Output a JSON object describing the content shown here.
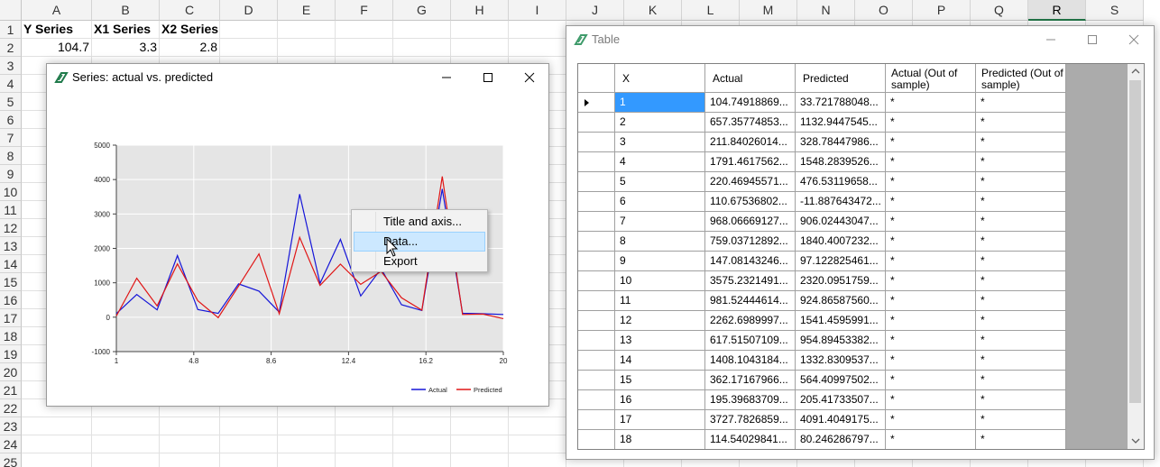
{
  "spreadsheet": {
    "columns": [
      "A",
      "B",
      "C",
      "D",
      "E",
      "F",
      "G",
      "H",
      "I",
      "J",
      "K",
      "L",
      "M",
      "N",
      "O",
      "P",
      "Q",
      "R",
      "S"
    ],
    "selected_column": "R",
    "rows": [
      "1",
      "2",
      "3",
      "4",
      "5",
      "6",
      "7",
      "8",
      "9",
      "10",
      "11",
      "12",
      "13",
      "14",
      "15",
      "16",
      "17",
      "18",
      "19",
      "20",
      "21",
      "22",
      "23",
      "24",
      "25"
    ],
    "headers": {
      "y_series": "Y Series",
      "x1_series": "X1 Series",
      "x2_series": "X2 Series"
    },
    "row2": {
      "y": "104.7",
      "x1": "3.3",
      "x2": "2.8"
    }
  },
  "chart_window": {
    "title": "Series: actual vs. predicted",
    "logo_icon": "green-leaf-icon",
    "controls": [
      "minimize-icon",
      "maximize-icon",
      "close-icon"
    ]
  },
  "context_menu": {
    "items": [
      "Title and axis...",
      "Data...",
      "Export"
    ],
    "hovered_index": 1
  },
  "chart_data": {
    "type": "line",
    "x": [
      1,
      2,
      3,
      4,
      5,
      6,
      7,
      8,
      9,
      10,
      11,
      12,
      13,
      14,
      15,
      16,
      17,
      18,
      19,
      20
    ],
    "x_ticks": [
      "1",
      "4.8",
      "8.6",
      "12.4",
      "16.2",
      "20"
    ],
    "y_ticks": [
      "5000",
      "4000",
      "3000",
      "2000",
      "1000",
      "0",
      "-1000"
    ],
    "xlim": [
      1,
      20
    ],
    "ylim": [
      -1000,
      5000
    ],
    "grid": true,
    "legend_position": "bottom-right",
    "series": [
      {
        "name": "Actual",
        "color": "#1515d8",
        "values": [
          104.7,
          657.4,
          211.8,
          1791.5,
          220.5,
          110.7,
          968.1,
          759.0,
          147.1,
          3575.2,
          981.5,
          2262.7,
          617.5,
          1408.1,
          362.2,
          195.4,
          3727.8,
          114.5,
          100,
          80
        ]
      },
      {
        "name": "Predicted",
        "color": "#e01515",
        "values": [
          33.7,
          1132.9,
          328.8,
          1548.3,
          476.5,
          -11.9,
          906.0,
          1840.0,
          97.1,
          2320.1,
          924.9,
          1541.5,
          954.9,
          1332.8,
          564.4,
          205.4,
          4091.4,
          80.2,
          90,
          -40
        ]
      }
    ]
  },
  "table_window": {
    "title": "Table",
    "logo_icon": "green-leaf-icon",
    "controls": [
      "minimize-icon",
      "maximize-icon",
      "close-icon"
    ],
    "columns": [
      "X",
      "Actual",
      "Predicted",
      "Actual (Out of sample)",
      "Predicted (Out of sample)"
    ],
    "selected_row_index": 0,
    "rows": [
      [
        "1",
        "104.74918869...",
        "33.721788048...",
        "*",
        "*"
      ],
      [
        "2",
        "657.35774853...",
        "1132.9447545...",
        "*",
        "*"
      ],
      [
        "3",
        "211.84026014...",
        "328.78447986...",
        "*",
        "*"
      ],
      [
        "4",
        "1791.4617562...",
        "1548.2839526...",
        "*",
        "*"
      ],
      [
        "5",
        "220.46945571...",
        "476.53119658...",
        "*",
        "*"
      ],
      [
        "6",
        "110.67536802...",
        "-11.887643472...",
        "*",
        "*"
      ],
      [
        "7",
        "968.06669127...",
        "906.02443047...",
        "*",
        "*"
      ],
      [
        "8",
        "759.03712892...",
        "1840.4007232...",
        "*",
        "*"
      ],
      [
        "9",
        "147.08143246...",
        "97.122825461...",
        "*",
        "*"
      ],
      [
        "10",
        "3575.2321491...",
        "2320.0951759...",
        "*",
        "*"
      ],
      [
        "11",
        "981.52444614...",
        "924.86587560...",
        "*",
        "*"
      ],
      [
        "12",
        "2262.6989997...",
        "1541.4595991...",
        "*",
        "*"
      ],
      [
        "13",
        "617.51507109...",
        "954.89453382...",
        "*",
        "*"
      ],
      [
        "14",
        "1408.1043184...",
        "1332.8309537...",
        "*",
        "*"
      ],
      [
        "15",
        "362.17167966...",
        "564.40997502...",
        "*",
        "*"
      ],
      [
        "16",
        "195.39683709...",
        "205.41733507...",
        "*",
        "*"
      ],
      [
        "17",
        "3727.7826859...",
        "4091.4049175...",
        "*",
        "*"
      ],
      [
        "18",
        "114.54029841...",
        "80.246286797...",
        "*",
        "*"
      ]
    ]
  }
}
